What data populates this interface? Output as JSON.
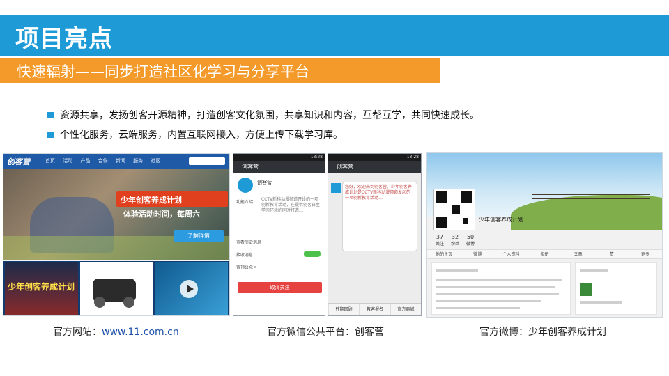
{
  "title": "项目亮点",
  "subtitle": "快速辐射——同步打造社区化学习与分享平台",
  "bullets": [
    "资源共享，发扬创客开源精神，打造创客文化氛围，共享知识和内容，互帮互学，共同快速成长。",
    "个性化服务，云端服务，内置互联网接入，方便上传下载学习库。"
  ],
  "website": {
    "logo": "创客营",
    "nav": "首页 活动 产品 合作 新闻 服务 社区",
    "hero_badge": "少年创客养成计划",
    "hero_time": "体验活动时间，每周六",
    "hero_button": "了解详情",
    "thumb_text": "少年创客养成计划"
  },
  "wechat": {
    "status": "13:28",
    "header": "创客营",
    "account_name": "创客营",
    "account_desc": "CCTV新科动漫频道开设的一项创新教育活动，在提供创客自主学习环境的同时打造…",
    "row_intro": "功能介绍",
    "row_history": "查看历史消息",
    "row_receive": "接收消息",
    "row_top": "置顶公众号",
    "cancel": "取消关注",
    "msg_text": "您好，欢迎来到创客营。少年创客养成计划是CCTV新科动漫频道发起的一项创新教育活动…",
    "tabs": [
      "往期回顾",
      "教客报名",
      "官方商城"
    ]
  },
  "weibo": {
    "name": "少年创客养成计划",
    "stats": [
      {
        "n": "37",
        "l": "关注"
      },
      {
        "n": "32",
        "l": "粉丝"
      },
      {
        "n": "50",
        "l": "微博"
      }
    ],
    "tabs": [
      "他的主页",
      "微博",
      "个人资料",
      "相册",
      "文章",
      "赞",
      "更多"
    ]
  },
  "captions": {
    "site_prefix": "官方网站：",
    "site_link": "www.11.com.cn",
    "wechat": "官方微信公共平台：创客营",
    "weibo": "官方微博：少年创客养成计划"
  }
}
